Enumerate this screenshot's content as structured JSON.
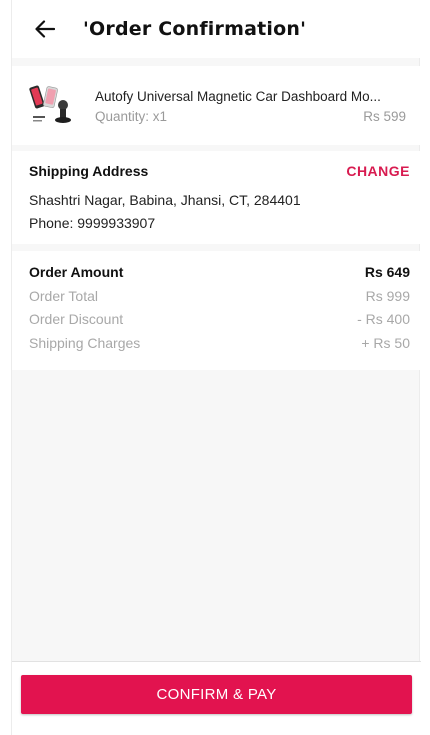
{
  "header": {
    "title": "'Order Confirmation'",
    "back_icon": "arrow-left-icon"
  },
  "product": {
    "name": "Autofy Universal Magnetic Car Dashboard Mo...",
    "quantity": "Quantity: x1",
    "price": "Rs 599",
    "thumbnail_icon": "product-thumbnail"
  },
  "shipping": {
    "title": "Shipping Address",
    "change_label": "CHANGE",
    "address": "Shashtri Nagar, Babina, Jhansi, CT, 284401",
    "phone": "Phone: 9999933907"
  },
  "order_amount": {
    "title": "Order Amount",
    "total": "Rs 649",
    "rows": [
      {
        "label": "Order Total",
        "value": "Rs 999"
      },
      {
        "label": "Order Discount",
        "value": "- Rs 400"
      },
      {
        "label": "Shipping Charges",
        "value": "+ Rs 50"
      }
    ]
  },
  "footer": {
    "confirm_label": "CONFIRM & PAY"
  },
  "colors": {
    "accent": "#e2134f",
    "change_link": "#d81b50",
    "muted_text": "#a8a8a8",
    "background": "#f7f7f7"
  }
}
